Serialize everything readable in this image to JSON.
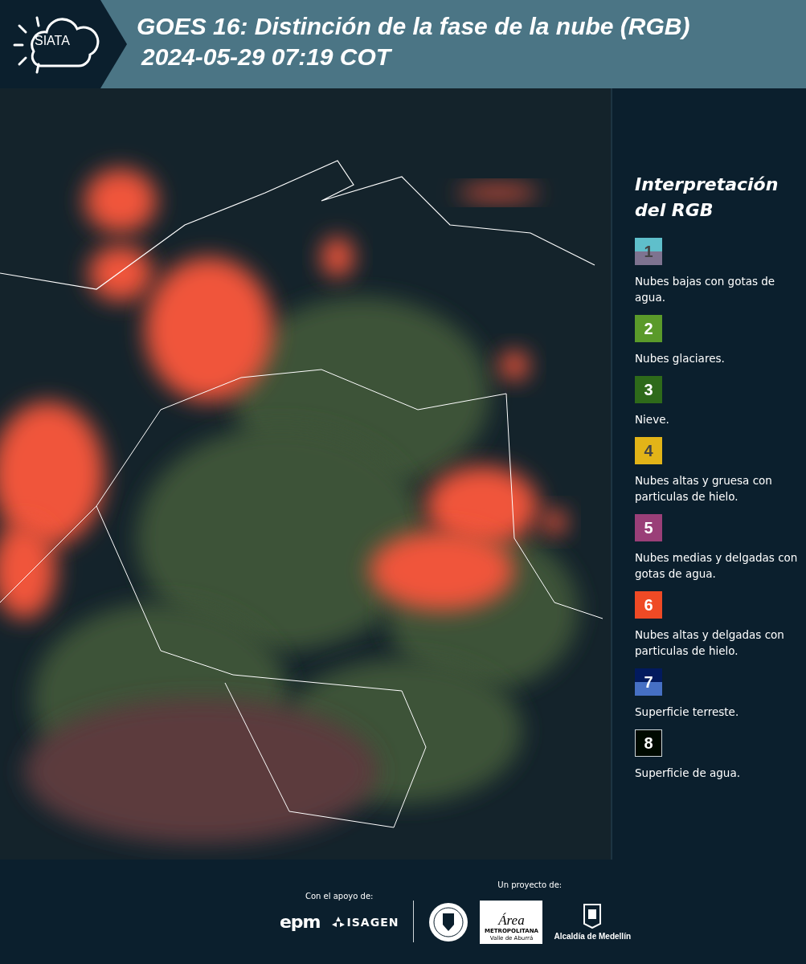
{
  "header": {
    "logo_text": "SIATA",
    "title": "GOES 16: Distinción de la fase de la nube (RGB)",
    "subtitle": "2024-05-29 07:19 COT"
  },
  "legend": {
    "title": "Interpretación del RGB",
    "items": [
      {
        "number": "1",
        "label": "Nubes bajas con gotas de agua.",
        "swatch": [
          {
            "color": "#5fbfcb"
          },
          {
            "color": "#7e7390"
          }
        ]
      },
      {
        "number": "2",
        "label": "Nubes glaciares.",
        "swatch": [
          {
            "color": "#5a9a2a"
          }
        ]
      },
      {
        "number": "3",
        "label": "Nieve.",
        "swatch": [
          {
            "color": "#2e6a1a"
          }
        ]
      },
      {
        "number": "4",
        "label": "Nubes altas y gruesa con particulas de hielo.",
        "swatch": [
          {
            "color": "#e2b418"
          }
        ]
      },
      {
        "number": "5",
        "label": "Nubes medias y delgadas con gotas de agua.",
        "swatch": [
          {
            "color": "#9a3f78"
          }
        ]
      },
      {
        "number": "6",
        "label": "Nubes altas y delgadas con particulas de hielo.",
        "swatch": [
          {
            "color": "#ef4a25"
          }
        ]
      },
      {
        "number": "7",
        "label": "Superficie terreste.",
        "swatch": [
          {
            "color": "#021a5e"
          },
          {
            "color": "#4670c4"
          }
        ]
      },
      {
        "number": "8",
        "label": "Superficie de agua.",
        "swatch": [
          {
            "color": "#000a00"
          }
        ]
      }
    ]
  },
  "footer": {
    "support_label": "Con el apoyo de:",
    "supporters": [
      "epm",
      "ISAGEN"
    ],
    "project_label": "Un proyecto de:",
    "area_logo": {
      "title": "Área",
      "line1": "METROPOLITANA",
      "line2": "Valle de Aburrá"
    },
    "alcaldia": "Alcaldía de Medellín"
  }
}
